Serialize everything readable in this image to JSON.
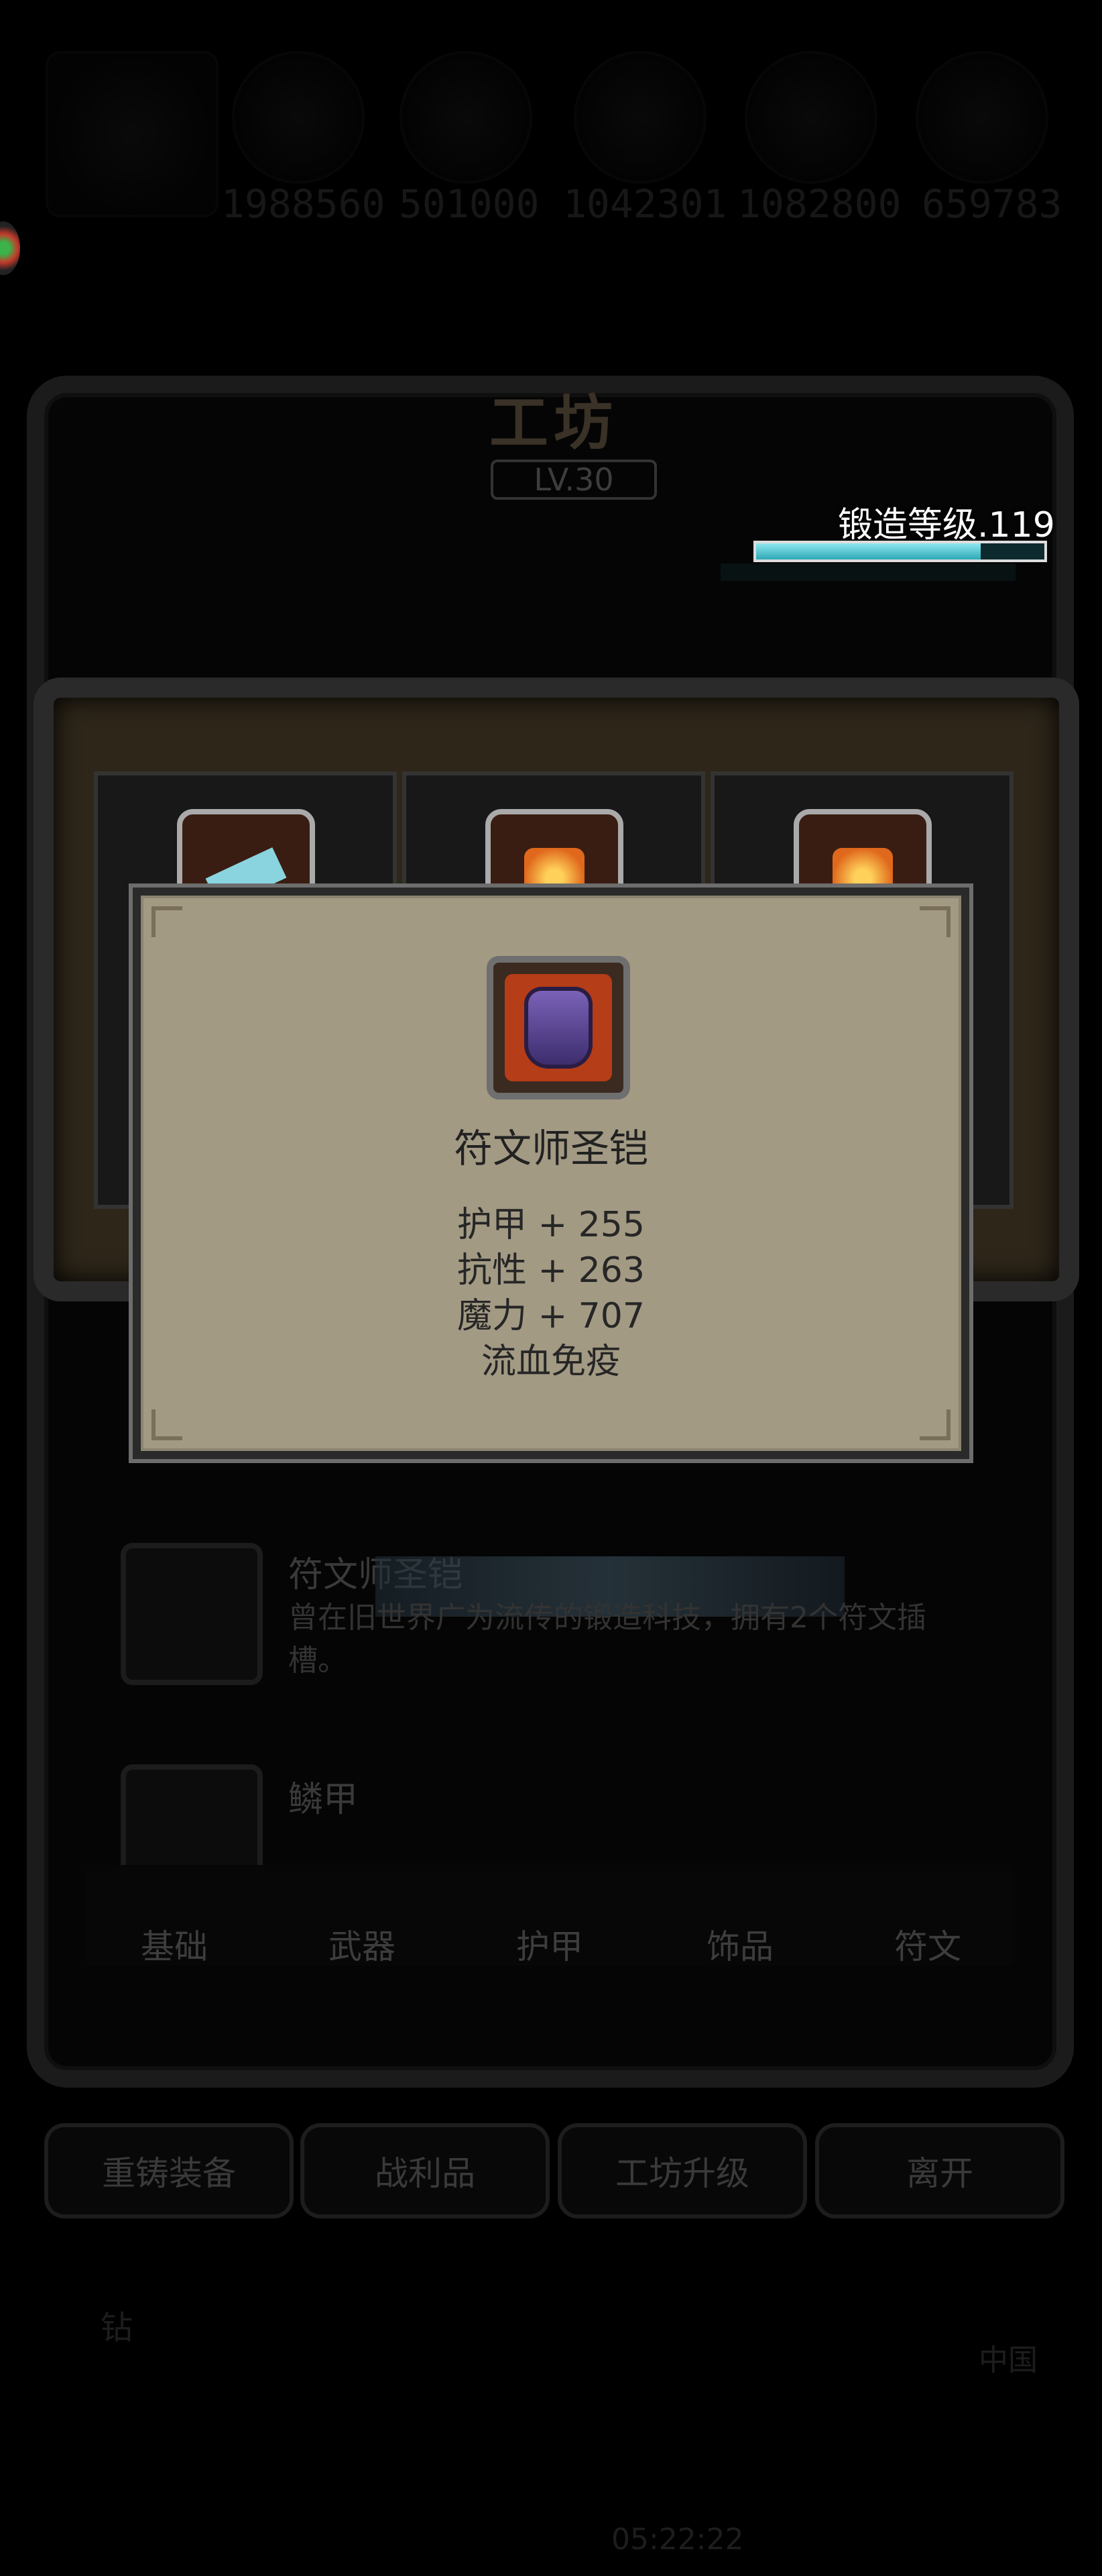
{
  "resources": [
    "1988560",
    "501000",
    "1042301",
    "1082800",
    "659783"
  ],
  "workshop": {
    "title": "工坊",
    "level": "LV.30",
    "forge_level": "锻造等级.119",
    "forge_progress": 0.78
  },
  "popup": {
    "item_name": "符文师圣铠",
    "stats": [
      "护甲 + 255",
      "抗性 + 263",
      "魔力 + 707",
      "流血免疫"
    ]
  },
  "list": [
    {
      "title": "符文师圣铠",
      "desc": "曾在旧世界广为流传的锻造科技，拥有2个符文插槽。"
    },
    {
      "title": "鳞甲",
      "desc": ""
    }
  ],
  "tabs": [
    "基础",
    "武器",
    "护甲",
    "饰品",
    "符文"
  ],
  "buttons": [
    "重铸装备",
    "战利品",
    "工坊升级",
    "离开"
  ],
  "footer": {
    "left_label": "钻",
    "right_label": "中国",
    "time": "05:22:22"
  }
}
